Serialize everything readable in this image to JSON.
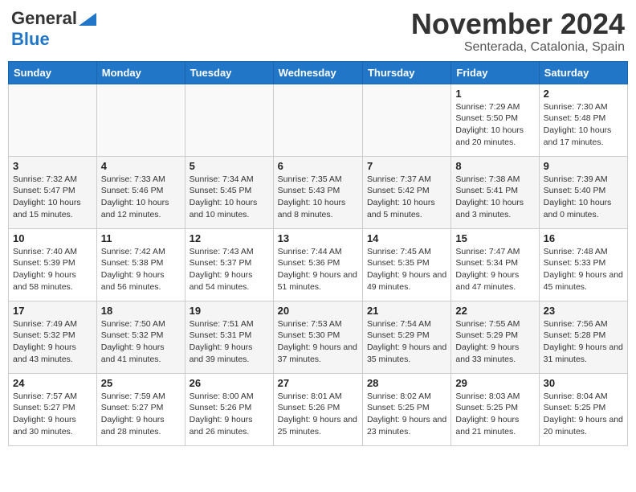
{
  "header": {
    "logo_general": "General",
    "logo_blue": "Blue",
    "month_title": "November 2024",
    "location": "Senterada, Catalonia, Spain"
  },
  "weekdays": [
    "Sunday",
    "Monday",
    "Tuesday",
    "Wednesday",
    "Thursday",
    "Friday",
    "Saturday"
  ],
  "weeks": [
    [
      {
        "day": "",
        "info": ""
      },
      {
        "day": "",
        "info": ""
      },
      {
        "day": "",
        "info": ""
      },
      {
        "day": "",
        "info": ""
      },
      {
        "day": "",
        "info": ""
      },
      {
        "day": "1",
        "info": "Sunrise: 7:29 AM\nSunset: 5:50 PM\nDaylight: 10 hours and 20 minutes."
      },
      {
        "day": "2",
        "info": "Sunrise: 7:30 AM\nSunset: 5:48 PM\nDaylight: 10 hours and 17 minutes."
      }
    ],
    [
      {
        "day": "3",
        "info": "Sunrise: 7:32 AM\nSunset: 5:47 PM\nDaylight: 10 hours and 15 minutes."
      },
      {
        "day": "4",
        "info": "Sunrise: 7:33 AM\nSunset: 5:46 PM\nDaylight: 10 hours and 12 minutes."
      },
      {
        "day": "5",
        "info": "Sunrise: 7:34 AM\nSunset: 5:45 PM\nDaylight: 10 hours and 10 minutes."
      },
      {
        "day": "6",
        "info": "Sunrise: 7:35 AM\nSunset: 5:43 PM\nDaylight: 10 hours and 8 minutes."
      },
      {
        "day": "7",
        "info": "Sunrise: 7:37 AM\nSunset: 5:42 PM\nDaylight: 10 hours and 5 minutes."
      },
      {
        "day": "8",
        "info": "Sunrise: 7:38 AM\nSunset: 5:41 PM\nDaylight: 10 hours and 3 minutes."
      },
      {
        "day": "9",
        "info": "Sunrise: 7:39 AM\nSunset: 5:40 PM\nDaylight: 10 hours and 0 minutes."
      }
    ],
    [
      {
        "day": "10",
        "info": "Sunrise: 7:40 AM\nSunset: 5:39 PM\nDaylight: 9 hours and 58 minutes."
      },
      {
        "day": "11",
        "info": "Sunrise: 7:42 AM\nSunset: 5:38 PM\nDaylight: 9 hours and 56 minutes."
      },
      {
        "day": "12",
        "info": "Sunrise: 7:43 AM\nSunset: 5:37 PM\nDaylight: 9 hours and 54 minutes."
      },
      {
        "day": "13",
        "info": "Sunrise: 7:44 AM\nSunset: 5:36 PM\nDaylight: 9 hours and 51 minutes."
      },
      {
        "day": "14",
        "info": "Sunrise: 7:45 AM\nSunset: 5:35 PM\nDaylight: 9 hours and 49 minutes."
      },
      {
        "day": "15",
        "info": "Sunrise: 7:47 AM\nSunset: 5:34 PM\nDaylight: 9 hours and 47 minutes."
      },
      {
        "day": "16",
        "info": "Sunrise: 7:48 AM\nSunset: 5:33 PM\nDaylight: 9 hours and 45 minutes."
      }
    ],
    [
      {
        "day": "17",
        "info": "Sunrise: 7:49 AM\nSunset: 5:32 PM\nDaylight: 9 hours and 43 minutes."
      },
      {
        "day": "18",
        "info": "Sunrise: 7:50 AM\nSunset: 5:32 PM\nDaylight: 9 hours and 41 minutes."
      },
      {
        "day": "19",
        "info": "Sunrise: 7:51 AM\nSunset: 5:31 PM\nDaylight: 9 hours and 39 minutes."
      },
      {
        "day": "20",
        "info": "Sunrise: 7:53 AM\nSunset: 5:30 PM\nDaylight: 9 hours and 37 minutes."
      },
      {
        "day": "21",
        "info": "Sunrise: 7:54 AM\nSunset: 5:29 PM\nDaylight: 9 hours and 35 minutes."
      },
      {
        "day": "22",
        "info": "Sunrise: 7:55 AM\nSunset: 5:29 PM\nDaylight: 9 hours and 33 minutes."
      },
      {
        "day": "23",
        "info": "Sunrise: 7:56 AM\nSunset: 5:28 PM\nDaylight: 9 hours and 31 minutes."
      }
    ],
    [
      {
        "day": "24",
        "info": "Sunrise: 7:57 AM\nSunset: 5:27 PM\nDaylight: 9 hours and 30 minutes."
      },
      {
        "day": "25",
        "info": "Sunrise: 7:59 AM\nSunset: 5:27 PM\nDaylight: 9 hours and 28 minutes."
      },
      {
        "day": "26",
        "info": "Sunrise: 8:00 AM\nSunset: 5:26 PM\nDaylight: 9 hours and 26 minutes."
      },
      {
        "day": "27",
        "info": "Sunrise: 8:01 AM\nSunset: 5:26 PM\nDaylight: 9 hours and 25 minutes."
      },
      {
        "day": "28",
        "info": "Sunrise: 8:02 AM\nSunset: 5:25 PM\nDaylight: 9 hours and 23 minutes."
      },
      {
        "day": "29",
        "info": "Sunrise: 8:03 AM\nSunset: 5:25 PM\nDaylight: 9 hours and 21 minutes."
      },
      {
        "day": "30",
        "info": "Sunrise: 8:04 AM\nSunset: 5:25 PM\nDaylight: 9 hours and 20 minutes."
      }
    ]
  ]
}
